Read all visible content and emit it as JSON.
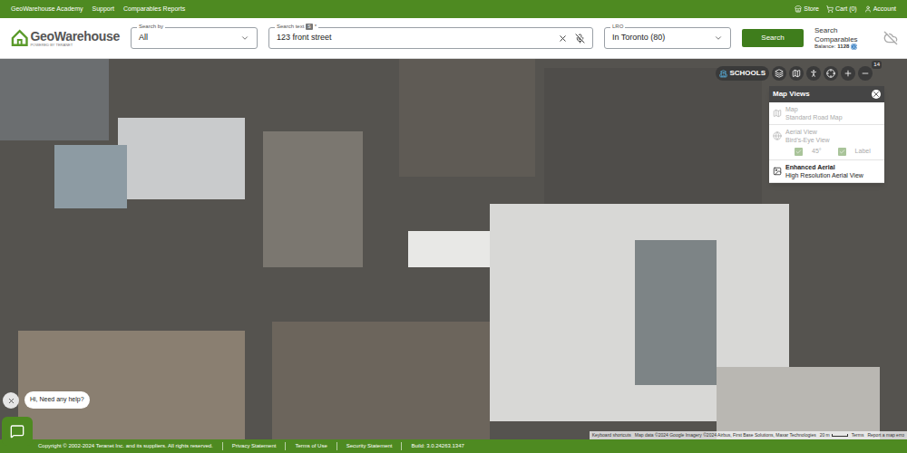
{
  "top_bar": {
    "links": [
      "GeoWarehouse Academy",
      "Support",
      "Comparables Reports"
    ],
    "right_links": [
      "Store",
      "Cart (0)",
      "Account"
    ]
  },
  "logo": {
    "name": "GeoWarehouse",
    "tagline": "POWERED BY TERANET"
  },
  "search_bar": {
    "search_by": {
      "label": "Search by",
      "value": "All"
    },
    "search_text": {
      "label": "Search text",
      "badge": "S",
      "required": "*",
      "value": "123 front street"
    },
    "lro": {
      "label": "LRO",
      "value": "In Toronto (80)"
    },
    "button": "Search",
    "comparables": {
      "title": "Search Comparables",
      "balance_label": "Balance:",
      "balance": "1128"
    }
  },
  "map": {
    "toolbar": {
      "schools": "SCHOOLS",
      "badge": "14"
    },
    "map_views": {
      "title": "Map Views",
      "options": [
        {
          "label": "Map",
          "description": "Standard Road Map",
          "selected": false,
          "disabled": true
        },
        {
          "label": "Aerial View",
          "description": "Bird's-Eye View",
          "selected": false,
          "disabled": true
        },
        {
          "label": "Enhanced Aerial",
          "description": "High Resolution Aerial View",
          "selected": true,
          "disabled": false
        }
      ],
      "sub_options": [
        {
          "label": "45°",
          "checked": true,
          "disabled": true
        },
        {
          "label": "Label",
          "checked": true,
          "disabled": true
        }
      ]
    },
    "attribution": [
      "Keyboard shortcuts",
      "Map data ©2024 Google Imagery ©2024 Airbus, First Base Solutions, Maxar Technologies"
    ],
    "scale": "20 m",
    "attribution_links": [
      "Terms",
      "Report a map erro"
    ]
  },
  "chat": {
    "greeting": "Hi, Need any help?"
  },
  "footer": {
    "copyright": "Copyright © 2002-2024 Teranet Inc. and its suppliers. All rights reserved.",
    "links": [
      "Privacy Statement",
      "Terms of Use",
      "Security Statement"
    ],
    "build": "Build: 3.0.24263.1347"
  }
}
